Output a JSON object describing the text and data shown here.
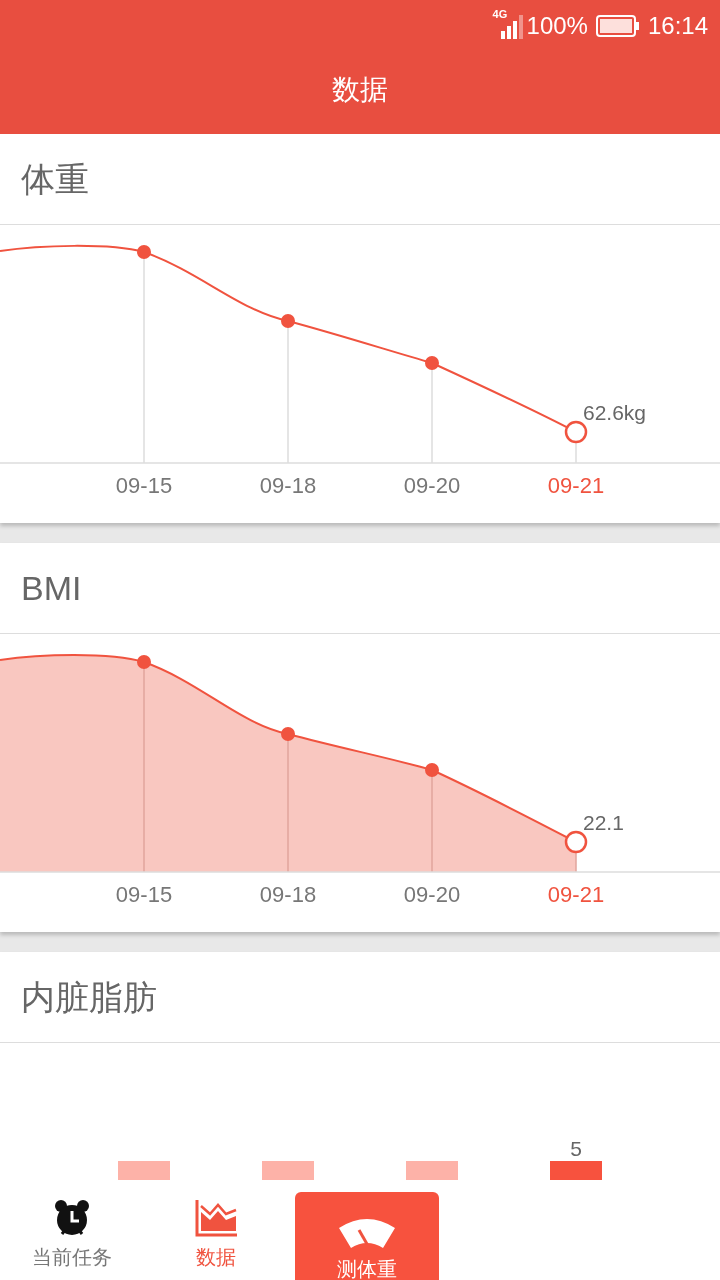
{
  "status_bar": {
    "network": "4G",
    "battery": "100%",
    "time": "16:14"
  },
  "header": {
    "title": "数据"
  },
  "cards": [
    {
      "title": "体重",
      "kind": "line",
      "x_labels": [
        {
          "label": "09-15",
          "selected": false
        },
        {
          "label": "09-18",
          "selected": false
        },
        {
          "label": "09-20",
          "selected": false
        },
        {
          "label": "09-21",
          "selected": true
        }
      ],
      "value_label": "62.6kg"
    },
    {
      "title": "BMI",
      "kind": "area",
      "x_labels": [
        {
          "label": "09-15",
          "selected": false
        },
        {
          "label": "09-18",
          "selected": false
        },
        {
          "label": "09-20",
          "selected": false
        },
        {
          "label": "09-21",
          "selected": true
        }
      ],
      "value_label": "22.1"
    },
    {
      "title": "内脏脂肪",
      "kind": "bar",
      "bars": [
        {
          "selected": false
        },
        {
          "selected": false
        },
        {
          "selected": false
        },
        {
          "selected": true,
          "value_label": "5"
        }
      ]
    }
  ],
  "bottom_nav": [
    {
      "label": "当前任务",
      "kind": "alarm",
      "selected": false
    },
    {
      "label": "数据",
      "kind": "chart",
      "selected": true
    },
    {
      "label": "测体重",
      "kind": "scale",
      "selected": false
    }
  ]
}
